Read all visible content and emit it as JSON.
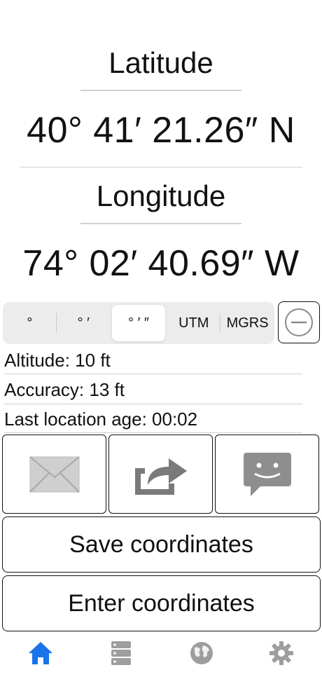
{
  "latitude": {
    "label": "Latitude",
    "value": "40° 41′ 21.26″ N"
  },
  "longitude": {
    "label": "Longitude",
    "value": "74° 02′ 40.69″ W"
  },
  "format_selector": {
    "options": [
      "°",
      "° ′",
      "° ′ ″",
      "UTM",
      "MGRS"
    ],
    "selected": "° ′ ″"
  },
  "info": {
    "altitude": "Altitude: 10 ft",
    "accuracy": "Accuracy: 13 ft",
    "location_age": "Last location age: 00:02"
  },
  "share_actions": {
    "icons": [
      "mail-icon",
      "share-icon",
      "message-icon"
    ]
  },
  "buttons": {
    "save": "Save coordinates",
    "enter": "Enter coordinates"
  },
  "tab_bar": {
    "icons": [
      "home-icon",
      "storage-icon",
      "globe-icon",
      "gear-icon"
    ],
    "active": "home-icon",
    "active_color": "#1a73e8",
    "inactive_color": "#9e9e9e"
  }
}
